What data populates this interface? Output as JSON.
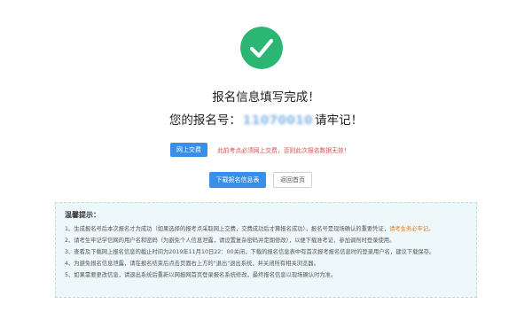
{
  "success_icon": {
    "name": "checkmark-icon",
    "color": "#2bb673"
  },
  "title": "报名信息填写完成！",
  "reg": {
    "prefix": "您的报名号：",
    "number": "11070010",
    "suffix": "请牢记！"
  },
  "pay": {
    "button_label": "网上交费",
    "notice": "此前考点必须网上交费，否则此次报名数据无效！"
  },
  "actions": {
    "download_label": "下载报名信息表",
    "home_label": "返回首页"
  },
  "tips": {
    "title": "温馨提示：",
    "items": [
      {
        "text": "1、生成报名号后本次报名才为成功（如果选择的报考点采取网上交费，交费成功后才算报名成功），报名号是现场确认的重要凭证，",
        "highlight": "请考生务必牢记。"
      },
      {
        "text": "2、请考生牢记学信网的用户名和密码（为避免个人信息泄露，请设置复杂密码并定期修改），以便下载准考证、参加调剂时登录使用。",
        "highlight": ""
      },
      {
        "text": "3、查看及下载网上报名信息的截止时间为2019年11月10日22：00关闭，下载的报名信息表中有首次报考报名信息时的登录用户名，建议下载保存。",
        "highlight": ""
      },
      {
        "text": "4、为避免报名信息泄露，请在报名结束后点击页面右上方的\"退出\"退出系统，并关闭所有相关浏览器。",
        "highlight": ""
      },
      {
        "text": "5、如果需要更改信息，请退出系统后重新以网报网首页登录报名系统修改，最终报名信息以现场确认时为准。",
        "highlight": ""
      }
    ]
  }
}
